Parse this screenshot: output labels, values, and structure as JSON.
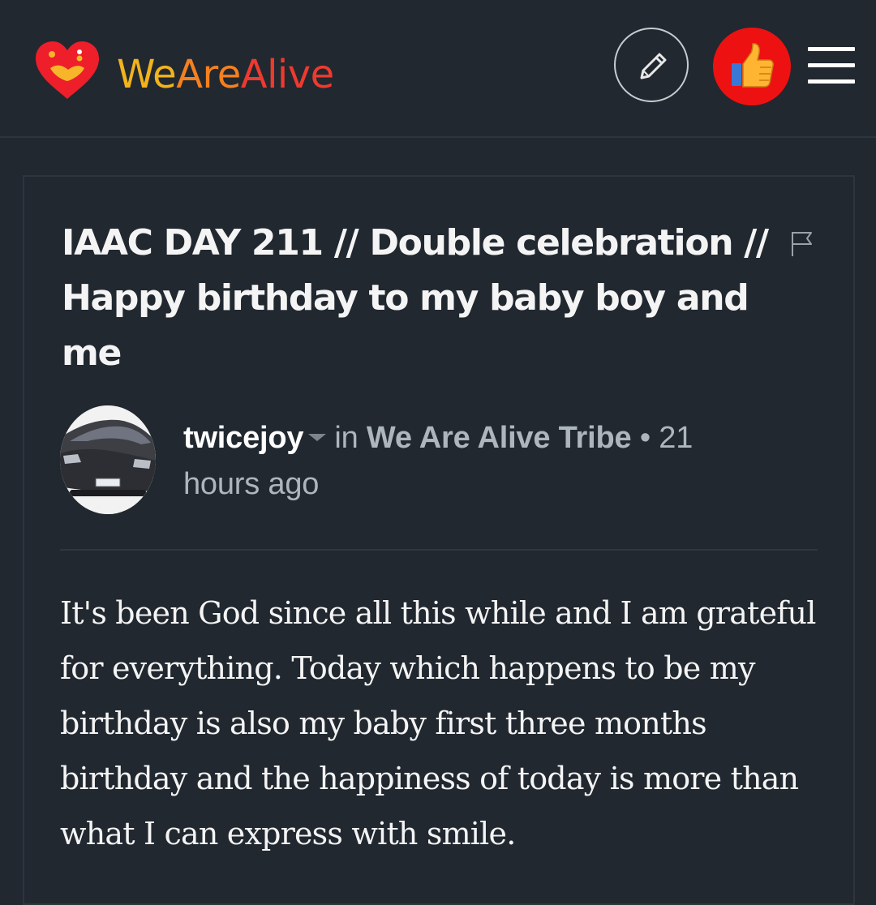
{
  "header": {
    "logo_text_parts": [
      "We",
      "Are",
      "Alive"
    ],
    "brand_colors": [
      "#f2b31c",
      "#f5801e",
      "#ee3a2e"
    ],
    "edit_icon": "pencil-icon",
    "vote_icon": "thumbs-up-icon",
    "vote_button_color": "#ee1111",
    "menu_icon": "hamburger-icon"
  },
  "post": {
    "title": "IAAC DAY 211 // Double celebration // Happy birthday to my baby boy and me",
    "flag_icon": "flag-icon",
    "author": "twicejoy",
    "in_label": "in",
    "community": "We Are Alive Tribe",
    "separator": "•",
    "time": "21 hours ago",
    "body": "It's been God since all this while and I am grateful for everything. Today which happens to be my birthday is also my baby first three months birthday and the happiness of today is more than what I can express with smile."
  }
}
